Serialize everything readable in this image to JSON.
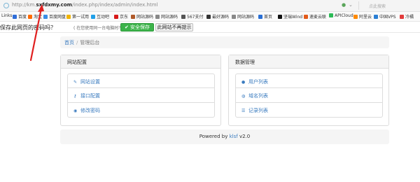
{
  "address_bar": {
    "url_prefix": "http://km.",
    "url_host": "sxfdxmy.com",
    "url_path": "/index.php/index/admin/index.html",
    "search_placeholder": "点此搜索"
  },
  "bookmarks": [
    {
      "label": "Links",
      "color": "#ffffff"
    },
    {
      "label": "百度",
      "color": "#2f6ed8"
    },
    {
      "label": "淘宝",
      "color": "#ff6a00"
    },
    {
      "label": "百度网盘",
      "color": "#3a8ee6"
    },
    {
      "label": "第一试用",
      "color": "#f0b400"
    },
    {
      "label": "互动吧",
      "color": "#21a0e8"
    },
    {
      "label": "京东",
      "color": "#d71a1a"
    },
    {
      "label": "网站源码",
      "color": "#b05a2a"
    },
    {
      "label": "网站源码",
      "color": "#888888"
    },
    {
      "label": "567支付",
      "color": "#555555"
    },
    {
      "label": "最好源码",
      "color": "#333333"
    },
    {
      "label": "网站源码",
      "color": "#888888"
    },
    {
      "label": "首页",
      "color": "#2a6fd4"
    },
    {
      "label": "坚瑞Wind",
      "color": "#111111"
    },
    {
      "label": "速麦云联",
      "color": "#e25b1a"
    },
    {
      "label": "APICloud",
      "color": "#2dbb57"
    },
    {
      "label": "阿里云",
      "color": "#ff8a00"
    },
    {
      "label": "中国VPS",
      "color": "#2a7fd4"
    },
    {
      "label": "冷橘",
      "color": "#e23c3c"
    }
  ],
  "password_bar": {
    "question": "保存此网页的密码吗？",
    "note": "( 在您使用同一台电脑时不建议保存 )",
    "save_label": "安全保存",
    "never_label": "此网站不再提示"
  },
  "breadcrumb": {
    "home": "首页",
    "separator": "/",
    "current": "管理后台"
  },
  "panels": {
    "site_config": {
      "title": "网站配置",
      "items": [
        {
          "icon": "edit-icon",
          "label": "网站设置"
        },
        {
          "icon": "key-icon",
          "label": "接口配置"
        },
        {
          "icon": "user-circle-icon",
          "label": "修改密码"
        }
      ]
    },
    "data_manage": {
      "title": "数据管理",
      "items": [
        {
          "icon": "user-icon",
          "label": "用户列表"
        },
        {
          "icon": "globe-icon",
          "label": "域名列表"
        },
        {
          "icon": "list-icon",
          "label": "记录列表"
        }
      ]
    }
  },
  "footer": {
    "prefix": "Powered by",
    "link": "klsf",
    "version": "v2.0"
  },
  "colors": {
    "accent": "#3a7bbf",
    "save_green": "#3cb34a",
    "annotation": "#e02020"
  }
}
